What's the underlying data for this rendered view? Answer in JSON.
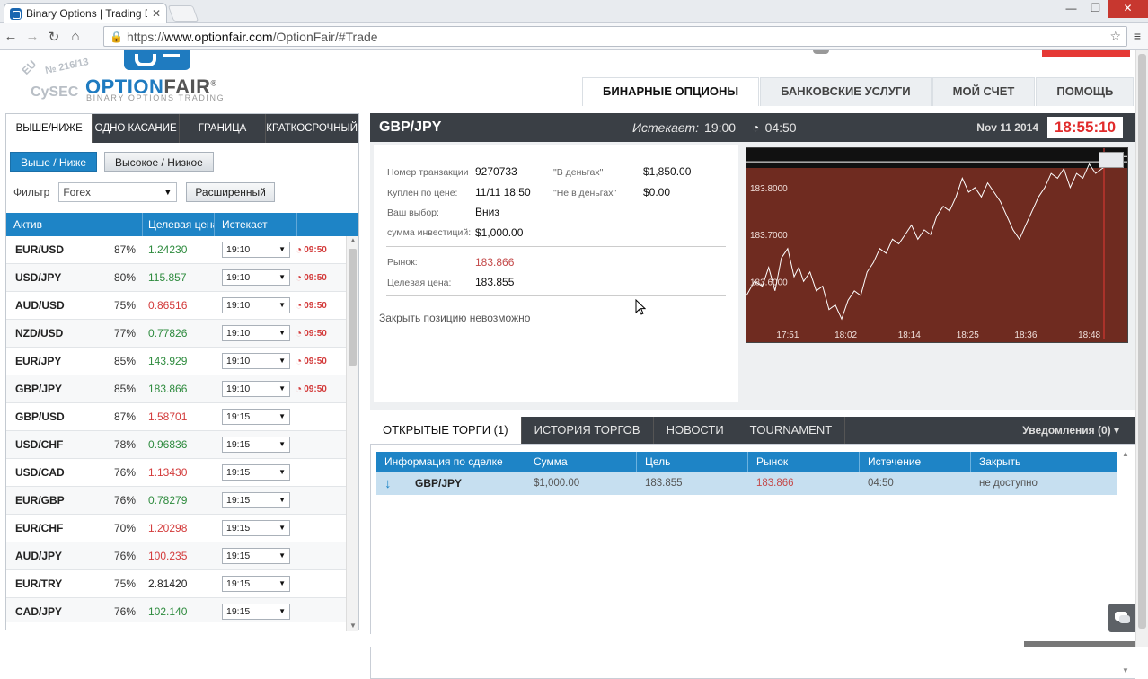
{
  "browser": {
    "tab_title": "Binary Options | Trading B",
    "tab_close": "✕",
    "win_min": "—",
    "win_max": "❐",
    "win_close": "✕",
    "url_scheme": "https://",
    "url_host": "www.optionfair.com",
    "url_path": "/OptionFair/#Trade",
    "nav_back": "←",
    "nav_forward": "→",
    "nav_reload": "↻",
    "nav_home": "⌂",
    "star": "☆",
    "menu": "≡"
  },
  "header": {
    "logo_text_a": "OPTION",
    "logo_text_b": "FAIR",
    "logo_reg": "®",
    "logo_sub": "BINARY OPTIONS TRADING",
    "stamp_eu": "EU",
    "stamp_no": "№ 216/13",
    "stamp_cysec": "CySEC",
    "nav": [
      "БИНАРНЫЕ ОПЦИОНЫ",
      "БАНКОВСКИЕ УСЛУГИ",
      "МОЙ СЧЕТ",
      "ПОМОЩЬ"
    ]
  },
  "left": {
    "tabs": [
      "ВЫШЕ/НИЖЕ",
      "ОДНО КАСАНИЕ",
      "ГРАНИЦА",
      "КРАТКОСРОЧНЫЙ"
    ],
    "subtabs": [
      "Выше / Ниже",
      "Высокое / Низкое"
    ],
    "filter_label": "Фильтр",
    "filter_value": "Forex",
    "advanced_button": "Расширенный",
    "table_headers": [
      "Актив",
      "Целевая цена",
      "Истекает"
    ],
    "rows": [
      {
        "name": "EUR/USD",
        "pct": "87%",
        "rate": "1.24230",
        "dir": "up",
        "exp": "19:10",
        "cd": "09:50"
      },
      {
        "name": "USD/JPY",
        "pct": "80%",
        "rate": "115.857",
        "dir": "up",
        "exp": "19:10",
        "cd": "09:50"
      },
      {
        "name": "AUD/USD",
        "pct": "75%",
        "rate": "0.86516",
        "dir": "down",
        "exp": "19:10",
        "cd": "09:50"
      },
      {
        "name": "NZD/USD",
        "pct": "77%",
        "rate": "0.77826",
        "dir": "up",
        "exp": "19:10",
        "cd": "09:50"
      },
      {
        "name": "EUR/JPY",
        "pct": "85%",
        "rate": "143.929",
        "dir": "up",
        "exp": "19:10",
        "cd": "09:50"
      },
      {
        "name": "GBP/JPY",
        "pct": "85%",
        "rate": "183.866",
        "dir": "up",
        "exp": "19:10",
        "cd": "09:50"
      },
      {
        "name": "GBP/USD",
        "pct": "87%",
        "rate": "1.58701",
        "dir": "down",
        "exp": "19:15",
        "cd": ""
      },
      {
        "name": "USD/CHF",
        "pct": "78%",
        "rate": "0.96836",
        "dir": "up",
        "exp": "19:15",
        "cd": ""
      },
      {
        "name": "USD/CAD",
        "pct": "76%",
        "rate": "1.13430",
        "dir": "down",
        "exp": "19:15",
        "cd": ""
      },
      {
        "name": "EUR/GBP",
        "pct": "76%",
        "rate": "0.78279",
        "dir": "up",
        "exp": "19:15",
        "cd": ""
      },
      {
        "name": "EUR/CHF",
        "pct": "70%",
        "rate": "1.20298",
        "dir": "down",
        "exp": "19:15",
        "cd": ""
      },
      {
        "name": "AUD/JPY",
        "pct": "76%",
        "rate": "100.235",
        "dir": "down",
        "exp": "19:15",
        "cd": ""
      },
      {
        "name": "EUR/TRY",
        "pct": "75%",
        "rate": "2.81420",
        "dir": "neutral",
        "exp": "19:15",
        "cd": ""
      },
      {
        "name": "CAD/JPY",
        "pct": "76%",
        "rate": "102.140",
        "dir": "up",
        "exp": "19:15",
        "cd": ""
      }
    ]
  },
  "trade": {
    "symbol": "GBP/JPY",
    "expires_label": "Истекает:",
    "expires_value": "19:00",
    "countdown": "04:50",
    "date": "Nov 11 2014",
    "time": "18:55:10",
    "info": {
      "txn_label": "Номер транзакции",
      "txn_value": "9270733",
      "bought_label": "Куплен по цене:",
      "bought_value": "11/11 18:50",
      "choice_label": "Ваш выбор:",
      "choice_value": "Вниз",
      "invest_label": "сумма инвестиций:",
      "invest_value": "$1,000.00",
      "itm_label": "\"В деньгах\"",
      "itm_value": "$1,850.00",
      "otm_label": "\"Не в деньгах\"",
      "otm_value": "$0.00",
      "market_label": "Рынок:",
      "market_value": "183.866",
      "target_label": "Целевая цена:",
      "target_value": "183.855",
      "close_note": "Закрыть позицию невозможно"
    }
  },
  "chart_data": {
    "type": "line",
    "yticks": [
      "183.8000",
      "183.7000",
      "183.6000"
    ],
    "ytick_values": [
      183.8,
      183.7,
      183.6
    ],
    "xticks": [
      "17:51",
      "18:02",
      "18:14",
      "18:25",
      "18:36",
      "18:48"
    ],
    "xtick_values": [
      17.85,
      18.033,
      18.233,
      18.417,
      18.6,
      18.8
    ],
    "xlim": [
      17.72,
      18.92
    ],
    "ylim": [
      183.505,
      183.88
    ],
    "target_line": 183.855,
    "grid": false,
    "series": [
      {
        "x": [
          17.72,
          17.745,
          17.77,
          17.79,
          17.81,
          17.83,
          17.85,
          17.87,
          17.885,
          17.9,
          17.92,
          17.94,
          17.96,
          17.98,
          18.0,
          18.02,
          18.04,
          18.06,
          18.08,
          18.1,
          18.12,
          18.14,
          18.16,
          18.18,
          18.2,
          18.22,
          18.24,
          18.26,
          18.28,
          18.3,
          18.32,
          18.34,
          18.36,
          18.38,
          18.4,
          18.42,
          18.44,
          18.46,
          18.48,
          18.5,
          18.52,
          18.54,
          18.56,
          18.58,
          18.6,
          18.62,
          18.64,
          18.66,
          18.68,
          18.7,
          18.72,
          18.74,
          18.76,
          18.78,
          18.8,
          18.82,
          18.84,
          18.86,
          18.88,
          18.9,
          18.92
        ],
        "y": [
          183.57,
          183.6,
          183.59,
          183.63,
          183.58,
          183.65,
          183.67,
          183.61,
          183.63,
          183.6,
          183.62,
          183.58,
          183.59,
          183.54,
          183.55,
          183.52,
          183.56,
          183.58,
          183.57,
          183.62,
          183.64,
          183.67,
          183.66,
          183.69,
          183.68,
          183.7,
          183.72,
          183.69,
          183.71,
          183.7,
          183.74,
          183.76,
          183.75,
          183.78,
          183.82,
          183.79,
          183.8,
          183.78,
          183.81,
          183.79,
          183.77,
          183.74,
          183.71,
          183.69,
          183.72,
          183.75,
          183.78,
          183.8,
          183.83,
          183.82,
          183.84,
          183.8,
          183.83,
          183.82,
          183.85,
          183.83,
          183.84,
          183.85,
          183.86,
          183.866,
          183.866
        ]
      }
    ]
  },
  "bottom": {
    "tabs": [
      "ОТКРЫТЫЕ ТОРГИ (1)",
      "ИСТОРИЯ ТОРГОВ",
      "НОВОСТИ",
      "TOURNAMENT"
    ],
    "notifications": "Уведомления (0) ▾",
    "headers": [
      "Информация по сделке",
      "Сумма",
      "Цель",
      "Рынок",
      "Истечение",
      "Закрыть"
    ],
    "row": {
      "arrow": "↓",
      "symbol": "GBP/JPY",
      "amount": "$1,000.00",
      "target": "183.855",
      "market": "183.866",
      "expiry": "04:50",
      "close": "не доступно"
    }
  },
  "colors": {
    "accent": "#1e84c6",
    "dark_bar": "#3a3f45",
    "chart_bg": "#6f2b20",
    "up": "#2e8b3e",
    "down": "#d33b3b"
  }
}
